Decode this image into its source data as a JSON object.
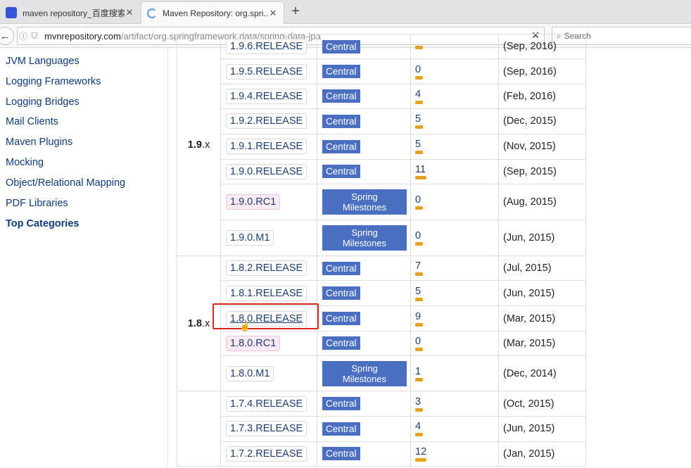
{
  "browser": {
    "tabs": [
      {
        "title": "maven repository_百度搜索",
        "active": false
      },
      {
        "title": "Maven Repository: org.spri...",
        "active": true
      }
    ],
    "url_host": "mvnrepository.com",
    "url_path": "/artifact/org.springframework.data/spring-data-jpa",
    "search_placeholder": "Search"
  },
  "sidebar": {
    "items": [
      {
        "label": "JVM Languages",
        "bold": false
      },
      {
        "label": "Logging Frameworks",
        "bold": false
      },
      {
        "label": "Logging Bridges",
        "bold": false
      },
      {
        "label": "Mail Clients",
        "bold": false
      },
      {
        "label": "Maven Plugins",
        "bold": false
      },
      {
        "label": "Mocking",
        "bold": false
      },
      {
        "label": "Object/Relational Mapping",
        "bold": false
      },
      {
        "label": "PDF Libraries",
        "bold": false
      },
      {
        "label": "Top Categories",
        "bold": true
      }
    ]
  },
  "groups": [
    {
      "major": "1.9",
      "suffix": ".x"
    },
    {
      "major": "1.8",
      "suffix": ".x"
    }
  ],
  "rows": [
    {
      "version": "1.9.6.RELEASE",
      "pre": false,
      "repo": "Central",
      "usages": "",
      "date": "(Sep, 2016)"
    },
    {
      "version": "1.9.5.RELEASE",
      "pre": false,
      "repo": "Central",
      "usages": "0",
      "date": "(Sep, 2016)"
    },
    {
      "version": "1.9.4.RELEASE",
      "pre": false,
      "repo": "Central",
      "usages": "4",
      "date": "(Feb, 2016)"
    },
    {
      "version": "1.9.2.RELEASE",
      "pre": false,
      "repo": "Central",
      "usages": "5",
      "date": "(Dec, 2015)"
    },
    {
      "version": "1.9.1.RELEASE",
      "pre": false,
      "repo": "Central",
      "usages": "5",
      "date": "(Nov, 2015)"
    },
    {
      "version": "1.9.0.RELEASE",
      "pre": false,
      "repo": "Central",
      "usages": "11",
      "date": "(Sep, 2015)"
    },
    {
      "version": "1.9.0.RC1",
      "pre": true,
      "repo": "Spring Milestones",
      "usages": "0",
      "date": "(Aug, 2015)"
    },
    {
      "version": "1.9.0.M1",
      "pre": false,
      "repo": "Spring Milestones",
      "usages": "0",
      "date": "(Jun, 2015)"
    },
    {
      "version": "1.8.2.RELEASE",
      "pre": false,
      "repo": "Central",
      "usages": "7",
      "date": "(Jul, 2015)"
    },
    {
      "version": "1.8.1.RELEASE",
      "pre": false,
      "repo": "Central",
      "usages": "5",
      "date": "(Jun, 2015)"
    },
    {
      "version": "1.8.0.RELEASE",
      "pre": false,
      "repo": "Central",
      "usages": "9",
      "date": "(Mar, 2015)"
    },
    {
      "version": "1.8.0.RC1",
      "pre": true,
      "repo": "Central",
      "usages": "0",
      "date": "(Mar, 2015)"
    },
    {
      "version": "1.8.0.M1",
      "pre": false,
      "repo": "Spring Milestones",
      "usages": "1",
      "date": "(Dec, 2014)"
    },
    {
      "version": "1.7.4.RELEASE",
      "pre": false,
      "repo": "Central",
      "usages": "3",
      "date": "(Oct, 2015)"
    },
    {
      "version": "1.7.3.RELEASE",
      "pre": false,
      "repo": "Central",
      "usages": "4",
      "date": "(Jun, 2015)"
    },
    {
      "version": "1.7.2.RELEASE",
      "pre": false,
      "repo": "Central",
      "usages": "12",
      "date": "(Jan, 2015)"
    }
  ],
  "spring_milestones": {
    "line1": "Spring",
    "line2": "Milestones"
  }
}
